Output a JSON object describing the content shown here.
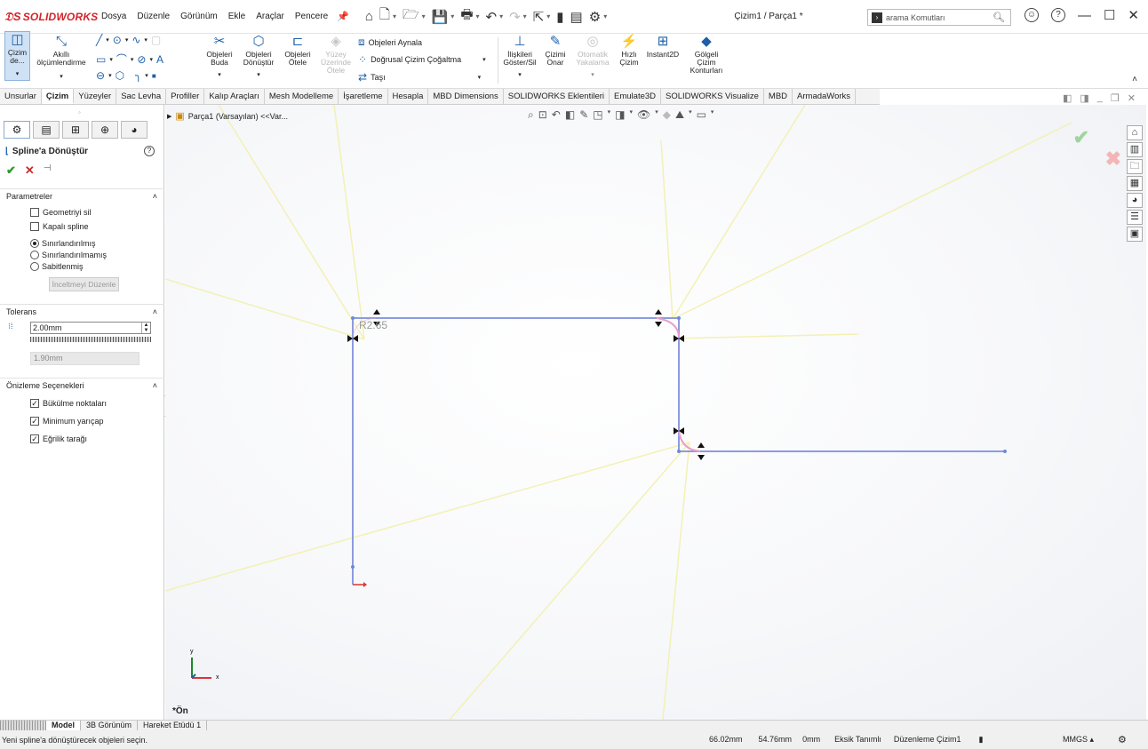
{
  "app": {
    "logo": "SOLIDWORKS",
    "title": "Çizim1 / Parça1 *"
  },
  "menu": [
    "Dosya",
    "Düzenle",
    "Görünüm",
    "Ekle",
    "Araçlar",
    "Pencere"
  ],
  "search": {
    "placeholder": "arama Komutları"
  },
  "ribbon": {
    "sketch": "Çizim de...",
    "smart_dim": "Akıllı ölçümlendirme",
    "trim": "Objeleri Buda",
    "convert": "Objeleri Dönüştür",
    "offset": "Objeleri Ötele",
    "surface_offset": "Yüzey Üzerinde Ötele",
    "mirror": "Objeleri Aynala",
    "linear_pattern": "Doğrusal Çizim Çoğaltma",
    "move": "Taşı",
    "relations": "İlişkileri Göster/Sil",
    "repair": "Çizimi Onar",
    "auto_dim": "Otomatik Yakalama",
    "quick_snap": "Hızlı Çizim",
    "instant2d": "Instant2D",
    "shaded": "Gölgeli Çizim Konturları"
  },
  "tabs": [
    "Unsurlar",
    "Çizim",
    "Yüzeyler",
    "Sac Levha",
    "Profiller",
    "Kalıp Araçları",
    "Mesh Modelleme",
    "İşaretleme",
    "Hesapla",
    "MBD Dimensions",
    "SOLIDWORKS Eklentileri",
    "Emulate3D",
    "SOLIDWORKS Visualize",
    "MBD",
    "ArmadaWorks"
  ],
  "active_tab": "Çizim",
  "panel": {
    "title": "Spline'a Dönüştür",
    "params_header": "Parametreler",
    "delete_geometry": "Geometriyi sil",
    "closed_spline": "Kapalı spline",
    "constrained": "Sınırlandırılmış",
    "unconstrained": "Sınırlandırılmamış",
    "fixed": "Sabitlenmiş",
    "tweak_button": "İnceltmeyi Düzenle",
    "tolerance_header": "Tolerans",
    "tolerance_value": "2.00mm",
    "tolerance_actual": "1.90mm",
    "preview_header": "Önizleme Seçenekleri",
    "inflection": "Bükülme noktaları",
    "min_radius": "Minimum yarıçap",
    "curvature_comb": "Eğrilik tarağı",
    "states": {
      "delete_geometry": false,
      "closed_spline": false,
      "inflection": true,
      "min_radius": true,
      "curvature_comb": true,
      "constraint": "constrained"
    }
  },
  "viewport": {
    "breadcrumb": "Parça1 (Varsayılan) <<Var...",
    "radius_label": "R2.65",
    "view_label": "*Ön",
    "triad_x": "x",
    "triad_y": "y"
  },
  "bottom_tabs": [
    "Model",
    "3B Görünüm",
    "Hareket Etüdü 1"
  ],
  "status": {
    "message": "Yeni spline'a dönüştürecek objeleri seçin.",
    "x": "66.02mm",
    "y": "54.76mm",
    "z": "0mm",
    "defined": "Eksik Tanımlı",
    "mode": "Düzenleme Çizim1",
    "units": "MMGS"
  },
  "colors": {
    "sketch": "#8c9be0",
    "pink": "#e8a0c8",
    "accent": "#1e5fa8",
    "ok": "#2f9a2f",
    "cancel": "#c72b2b"
  }
}
